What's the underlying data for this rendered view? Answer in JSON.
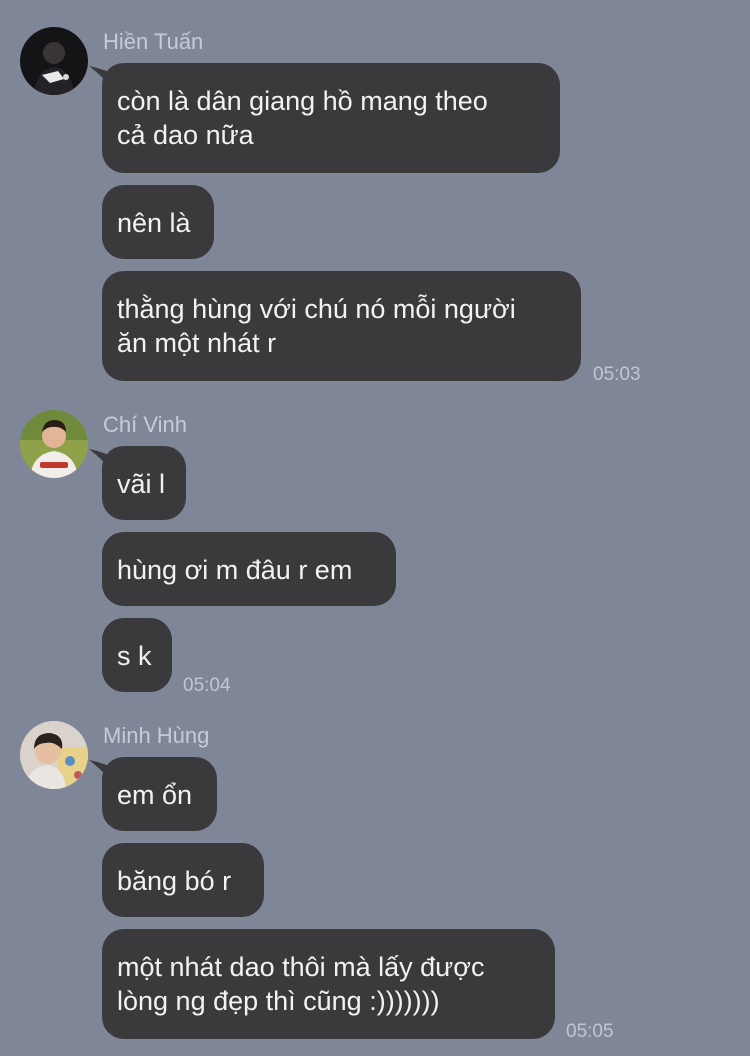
{
  "groups": [
    {
      "sender": "Hiền Tuấn",
      "avatar_icon": "avatar-dark-portrait",
      "messages": [
        {
          "line1": "còn là dân giang hồ mang theo",
          "line2": "cả dao nữa"
        },
        {
          "line1": "nên là",
          "line2": ""
        },
        {
          "line1": "thằng hùng với chú nó mỗi người",
          "line2": "ăn một nhát r"
        }
      ],
      "time": "05:03"
    },
    {
      "sender": "Chí Vinh",
      "avatar_icon": "avatar-jersey-portrait",
      "messages": [
        {
          "line1": "vãi l",
          "line2": ""
        },
        {
          "line1": "hùng ơi m đâu r em",
          "line2": ""
        },
        {
          "line1": "s k",
          "line2": ""
        }
      ],
      "time": "05:04"
    },
    {
      "sender": "Minh Hùng",
      "avatar_icon": "avatar-selfie-portrait",
      "messages": [
        {
          "line1": "em ổn",
          "line2": ""
        },
        {
          "line1": "băng bó r",
          "line2": ""
        },
        {
          "line1": "một nhát dao thôi mà lấy được",
          "line2": "lòng ng đẹp thì cũng :)))))))"
        }
      ],
      "time": "05:05"
    }
  ],
  "colors": {
    "background": "#7f8698",
    "bubble": "#3a3a3c",
    "bubble_text": "#f2f2f2",
    "meta_text": "#c7cbd4"
  }
}
